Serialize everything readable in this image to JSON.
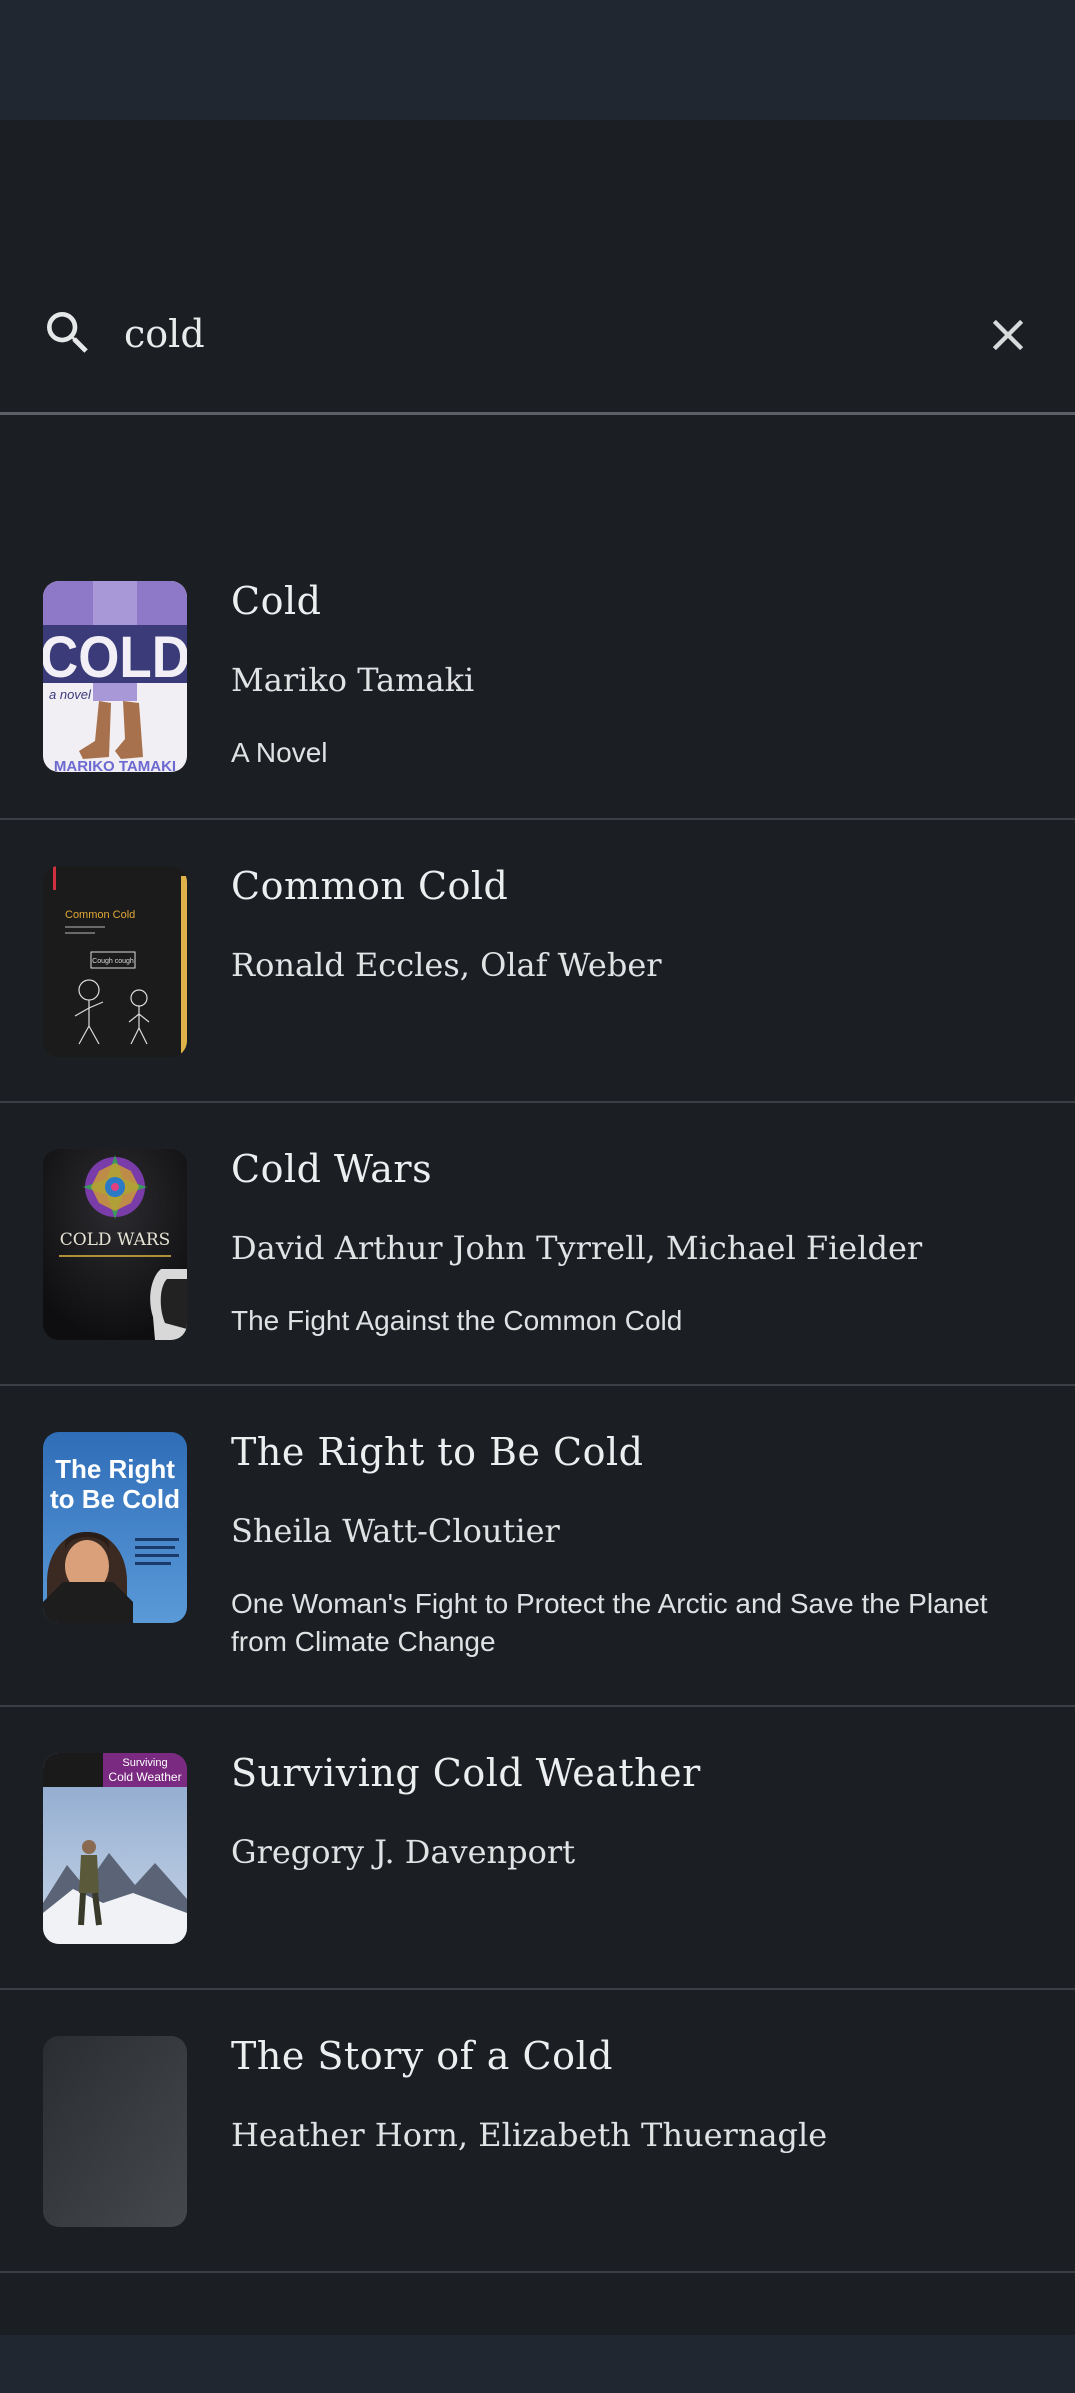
{
  "search": {
    "query": "cold"
  },
  "results": [
    {
      "title": "Cold",
      "author": "Mariko Tamaki",
      "subtitle": "A Novel",
      "cover": {
        "main_text": "COLD",
        "tag_text": "a novel",
        "footer_text": "MARIKO TAMAKI"
      }
    },
    {
      "title": "Common Cold",
      "author": "Ronald Eccles, Olaf Weber",
      "subtitle": "",
      "cover": {
        "main_text": "Common Cold",
        "bubble_text": "Cough cough"
      }
    },
    {
      "title": "Cold Wars",
      "author": "David Arthur John Tyrrell, Michael Fielder",
      "subtitle": "The Fight Against the Common Cold",
      "cover": {
        "main_text": "COLD WARS"
      }
    },
    {
      "title": "The Right to Be Cold",
      "author": "Sheila Watt-Cloutier",
      "subtitle": "One Woman's Fight to Protect the Arctic and Save the Planet from Climate Change",
      "cover": {
        "main_text": "The Right to Be Cold",
        "line1": "The Right",
        "line2": "to Be Cold"
      }
    },
    {
      "title": "Surviving Cold Weather",
      "author": "Gregory J. Davenport",
      "subtitle": "",
      "cover": {
        "line1": "Surviving",
        "line2": "Cold Weather"
      }
    },
    {
      "title": "The Story of a Cold",
      "author": "Heather Horn, Elizabeth Thuernagle",
      "subtitle": ""
    }
  ]
}
